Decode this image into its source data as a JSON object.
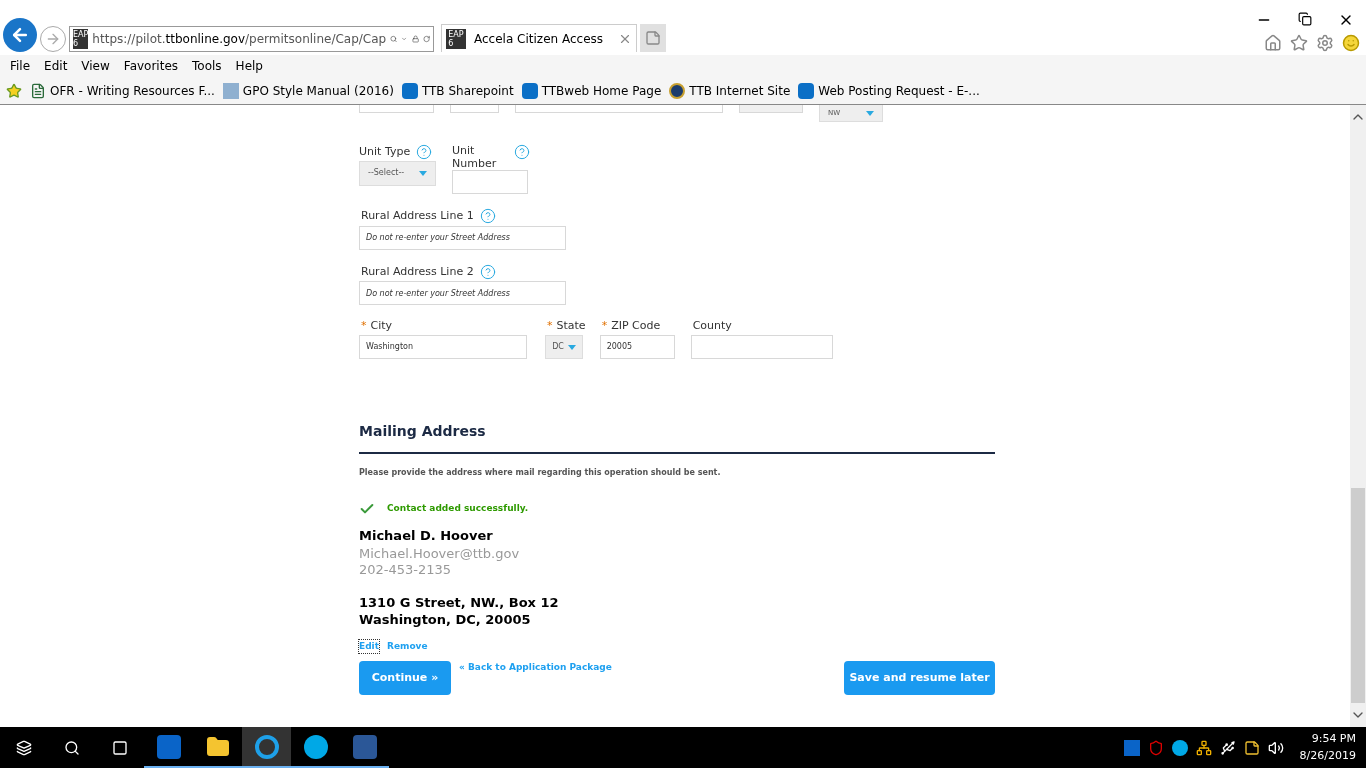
{
  "browser": {
    "url_parts": [
      {
        "text": "https://",
        "strong": false
      },
      {
        "text": "pilot.",
        "strong": false
      },
      {
        "text": "ttbonline.gov",
        "strong": true
      },
      {
        "text": "/permitsonline/Cap/Cap",
        "strong": false
      }
    ],
    "site_badge": "EAP\n6",
    "tabs": [
      {
        "title": "Accela Citizen Access",
        "badge": "EAP\n6",
        "selected": true
      }
    ],
    "menu": [
      "File",
      "Edit",
      "View",
      "Favorites",
      "Tools",
      "Help"
    ],
    "favorites": [
      {
        "label": "OFR - Writing Resources F...",
        "kind": "page"
      },
      {
        "label": "GPO Style Manual (2016)",
        "kind": "gpo"
      },
      {
        "label": "TTB Sharepoint",
        "kind": "sharepoint"
      },
      {
        "label": "TTBweb Home Page",
        "kind": "sharepoint"
      },
      {
        "label": "TTB Internet Site",
        "kind": "seal"
      },
      {
        "label": "Web Posting Request - E-...",
        "kind": "sharepoint"
      }
    ]
  },
  "form": {
    "cut_row_select": "NW",
    "unit_type": {
      "label": "Unit Type",
      "value": "--Select--"
    },
    "unit_number": {
      "label": "Unit Number"
    },
    "rural": [
      {
        "label": "Rural Address Line 1",
        "placeholder": "Do not re-enter your Street Address"
      },
      {
        "label": "Rural Address Line 2",
        "placeholder": "Do not re-enter your Street Address"
      }
    ],
    "required_mark": "*",
    "city": {
      "label": "City",
      "value": "Washington",
      "required": true
    },
    "state": {
      "label": "State",
      "value": "DC",
      "required": true
    },
    "zip": {
      "label": "ZIP Code",
      "value": "20005",
      "required": true
    },
    "county": {
      "label": "County",
      "required": false
    }
  },
  "mailing": {
    "title": "Mailing Address",
    "intro": "Please provide the address where mail regarding this operation should be sent.",
    "message": "Contact added successfully.",
    "name": "Michael D. Hoover",
    "email": "Michael.Hoover@ttb.gov",
    "phone": "202-453-2135",
    "address": [
      "1310 G Street, NW., Box 12",
      "Washington, DC, 20005"
    ],
    "links": [
      "Edit",
      "Remove"
    ],
    "continue": "Continue »",
    "back": "« Back to Application Package",
    "save": "Save and resume later"
  },
  "taskbar": {
    "apps": [
      {
        "kind": "outlook",
        "selected": false
      },
      {
        "kind": "explorer",
        "selected": false
      },
      {
        "kind": "ie",
        "selected": true
      },
      {
        "kind": "skype",
        "selected": false
      },
      {
        "kind": "word",
        "selected": false
      }
    ],
    "time": "9:54 PM",
    "date": "8/26/2019"
  }
}
